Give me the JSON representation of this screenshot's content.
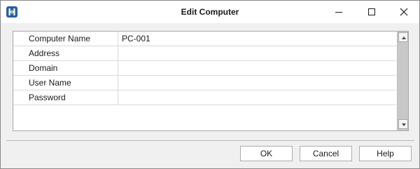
{
  "window": {
    "title": "Edit Computer",
    "icon": "app-logo-icon",
    "controls": [
      "minimize-icon",
      "maximize-icon",
      "close-icon"
    ]
  },
  "properties": [
    {
      "label": "Computer Name",
      "value": "PC-001"
    },
    {
      "label": "Address",
      "value": ""
    },
    {
      "label": "Domain",
      "value": ""
    },
    {
      "label": "User Name",
      "value": ""
    },
    {
      "label": "Password",
      "value": ""
    }
  ],
  "buttons": {
    "ok": "OK",
    "cancel": "Cancel",
    "help": "Help"
  },
  "colors": {
    "app_icon": "#2b5ea8",
    "dialog_background": "#f0f0f0",
    "scrollbar_track": "#c8c8c8"
  }
}
